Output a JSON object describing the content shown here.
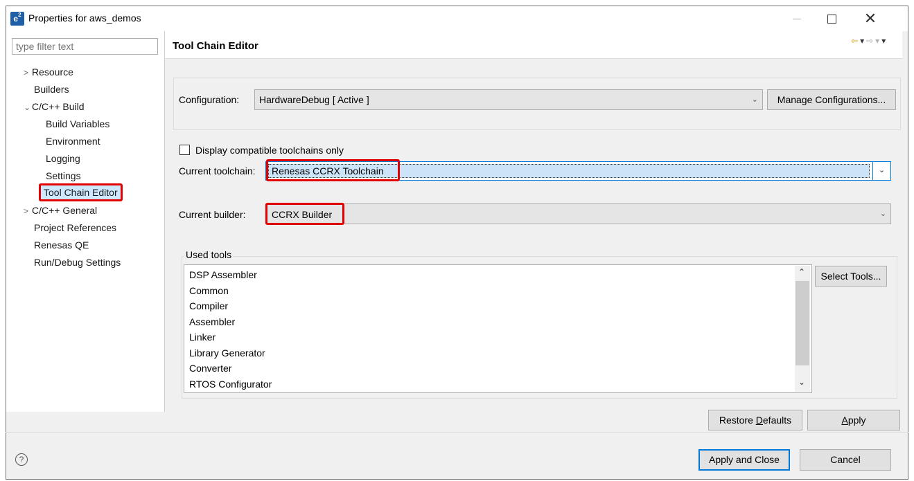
{
  "window": {
    "title": "Properties for aws_demos",
    "app_icon": "e2-icon",
    "close_glyph": "✕"
  },
  "filter": {
    "placeholder": "type filter text"
  },
  "tree": [
    {
      "label": "Resource",
      "arrow": ">"
    },
    {
      "label": "Builders",
      "arrow": ""
    },
    {
      "label": "C/C++ Build",
      "arrow": "⌄"
    },
    {
      "label": "Build Variables",
      "arrow": ""
    },
    {
      "label": "Environment",
      "arrow": ""
    },
    {
      "label": "Logging",
      "arrow": ""
    },
    {
      "label": "Settings",
      "arrow": ""
    },
    {
      "label": "Tool Chain Editor",
      "arrow": "",
      "selected": true
    },
    {
      "label": "C/C++ General",
      "arrow": ">"
    },
    {
      "label": "Project References",
      "arrow": ""
    },
    {
      "label": "Renesas QE",
      "arrow": ""
    },
    {
      "label": "Run/Debug Settings",
      "arrow": ""
    }
  ],
  "page": {
    "title": "Tool Chain Editor",
    "configuration_label": "Configuration:",
    "configuration_value": "HardwareDebug  [ Active ]",
    "manage_button": "Manage Configurations...",
    "display_compatible": "Display compatible toolchains only",
    "current_toolchain_label": "Current toolchain:",
    "current_toolchain_value": "Renesas CCRX Toolchain",
    "current_builder_label": "Current builder:",
    "current_builder_value": "CCRX Builder",
    "used_tools_label": "Used tools",
    "select_tools_button": "Select Tools...",
    "used_tools": [
      "DSP Assembler",
      "Common",
      "Compiler",
      "Assembler",
      "Linker",
      "Library Generator",
      "Converter",
      "RTOS Configurator"
    ],
    "restore_defaults_pre": "Restore ",
    "restore_defaults_acc": "D",
    "restore_defaults_post": "efaults",
    "apply_acc": "A",
    "apply_post": "pply"
  },
  "footer": {
    "help": "?",
    "apply_and_close": "Apply and Close",
    "cancel": "Cancel"
  },
  "colors": {
    "highlight": "#e00000",
    "accent": "#0078d7"
  }
}
